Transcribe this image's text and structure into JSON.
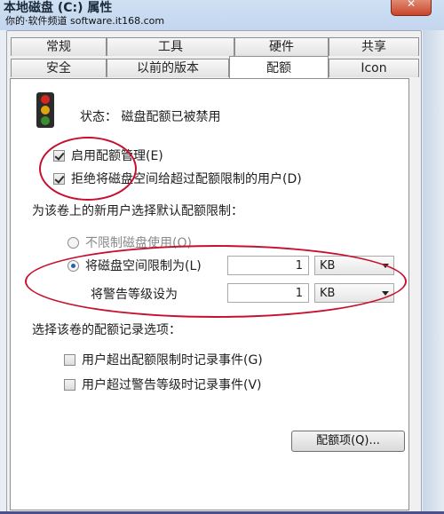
{
  "window": {
    "title": "本地磁盘 (C:) 属性",
    "watermark": "你的·软件频道 software.it168.com"
  },
  "tabs_row1": [
    "常规",
    "工具",
    "硬件",
    "共享"
  ],
  "tabs_row2": [
    "安全",
    "以前的版本",
    "配额",
    "Icon"
  ],
  "active_tab": "配额",
  "status": "状态：  磁盘配额已被禁用",
  "enable_quota": {
    "label": "启用配额管理(E)",
    "checked": true
  },
  "deny_space": {
    "label": "拒绝将磁盘空间给超过配额限制的用户(D)",
    "checked": true
  },
  "default_limit_heading": "为该卷上的新用户选择默认配额限制：",
  "radio_no_limit": "不限制磁盘使用(O)",
  "radio_limit": "将磁盘空间限制为(L)",
  "limit": {
    "value": "1",
    "unit": "KB"
  },
  "warning": {
    "label": "将警告等级设为",
    "value": "1",
    "unit": "KB"
  },
  "logging_heading": "选择该卷的配额记录选项：",
  "log_exceed_limit": {
    "label": "用户超出配额限制时记录事件(G)",
    "checked": false
  },
  "log_exceed_warning": {
    "label": "用户超过警告等级时记录事件(V)",
    "checked": false
  },
  "quota_entries_button": "配额项(Q)...",
  "colors": {
    "annotation": "#c8102e",
    "accent": "#2a5fb0"
  }
}
